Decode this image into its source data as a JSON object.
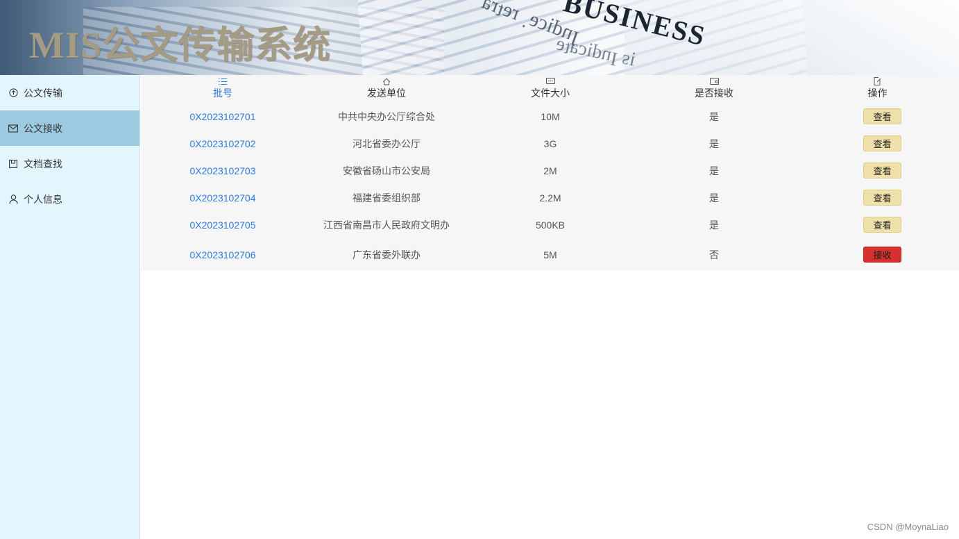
{
  "header": {
    "title": "MIS公文传输系统",
    "background_word": "BUSINESS"
  },
  "sidebar": {
    "items": [
      {
        "label": "公文传输",
        "icon": "upload-circle-icon",
        "active": false
      },
      {
        "label": "公文接收",
        "icon": "mail-icon",
        "active": true
      },
      {
        "label": "文档查找",
        "icon": "archive-icon",
        "active": false
      },
      {
        "label": "个人信息",
        "icon": "user-icon",
        "active": false
      }
    ]
  },
  "table": {
    "columns": [
      {
        "label": "批号",
        "icon": "list-icon"
      },
      {
        "label": "发送单位",
        "icon": "home-icon"
      },
      {
        "label": "文件大小",
        "icon": "message-dots-icon"
      },
      {
        "label": "是否接收",
        "icon": "wallet-icon"
      },
      {
        "label": "操作",
        "icon": "edit-doc-icon"
      }
    ],
    "rows": [
      {
        "id": "0X2023102701",
        "sender": "中共中央办公厅综合处",
        "size": "10M",
        "received": "是",
        "action": "查看"
      },
      {
        "id": "0X2023102702",
        "sender": "河北省委办公厅",
        "size": "3G",
        "received": "是",
        "action": "查看"
      },
      {
        "id": "0X2023102703",
        "sender": "安徽省砀山市公安局",
        "size": "2M",
        "received": "是",
        "action": "查看"
      },
      {
        "id": "0X2023102704",
        "sender": "福建省委组织部",
        "size": "2.2M",
        "received": "是",
        "action": "查看"
      },
      {
        "id": "0X2023102705",
        "sender": "江西省南昌市人民政府文明办",
        "size": "500KB",
        "received": "是",
        "action": "查看"
      },
      {
        "id": "0X2023102706",
        "sender": "广东省委外联办",
        "size": "5M",
        "received": "否",
        "action": "接收"
      }
    ]
  },
  "colors": {
    "accent_blue": "#2a7ae2",
    "sidebar_bg": "#e4f6fd",
    "sidebar_active": "#9ecae1",
    "view_button": "#efdfa8",
    "receive_button": "#d6312f"
  },
  "footer": {
    "credit": "CSDN @MoynaLiao"
  }
}
